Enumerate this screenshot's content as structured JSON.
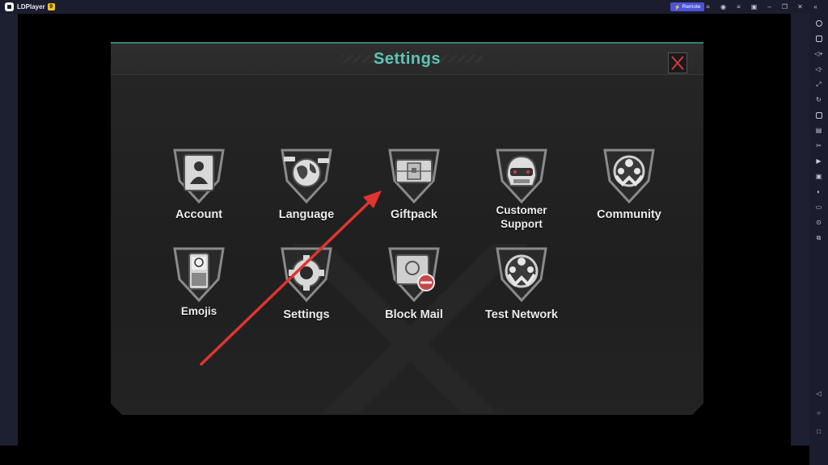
{
  "app": {
    "name": "LDPlayer",
    "badge": "9",
    "remote_label": "Remote"
  },
  "window_controls": [
    "gamepad-icon",
    "user-icon",
    "menu-icon",
    "screen-icon",
    "minimize-icon",
    "restore-icon",
    "close-icon",
    "collapse-icon"
  ],
  "sidebar_icons": [
    "settings-icon",
    "keyboard-icon",
    "volume-up-icon",
    "volume-down-icon",
    "resize-icon",
    "sync-icon",
    "apk-install-icon",
    "screenshot-icon",
    "scissors-icon",
    "record-icon",
    "multi-instance-icon",
    "operation-record-icon",
    "folder-icon",
    "location-icon",
    "shake-icon"
  ],
  "nav_buttons": [
    "back-icon",
    "home-icon",
    "recents-icon"
  ],
  "settings": {
    "title": "Settings",
    "tiles": [
      {
        "label": "Account",
        "icon": "account-icon"
      },
      {
        "label": "Language",
        "icon": "globe-icon"
      },
      {
        "label": "Giftpack",
        "icon": "giftbox-icon"
      },
      {
        "label_line1": "Customer",
        "label_line2": "Support",
        "icon": "support-helmet-icon"
      },
      {
        "label": "Community",
        "icon": "community-icon"
      },
      {
        "label": "Emojis",
        "icon": "phone-emoji-icon"
      },
      {
        "label": "Settings",
        "icon": "gear-icon"
      },
      {
        "label": "Block Mail",
        "icon": "block-mail-icon"
      },
      {
        "label": "Test Network",
        "icon": "network-icon"
      }
    ]
  },
  "colors": {
    "title": "#5fc4b4",
    "accent_line": "#3b7f76",
    "chrome": "#1b1d2e",
    "remote": "#4b54d8",
    "arrow": "#e0352f",
    "close_x": "#d23b3b"
  }
}
